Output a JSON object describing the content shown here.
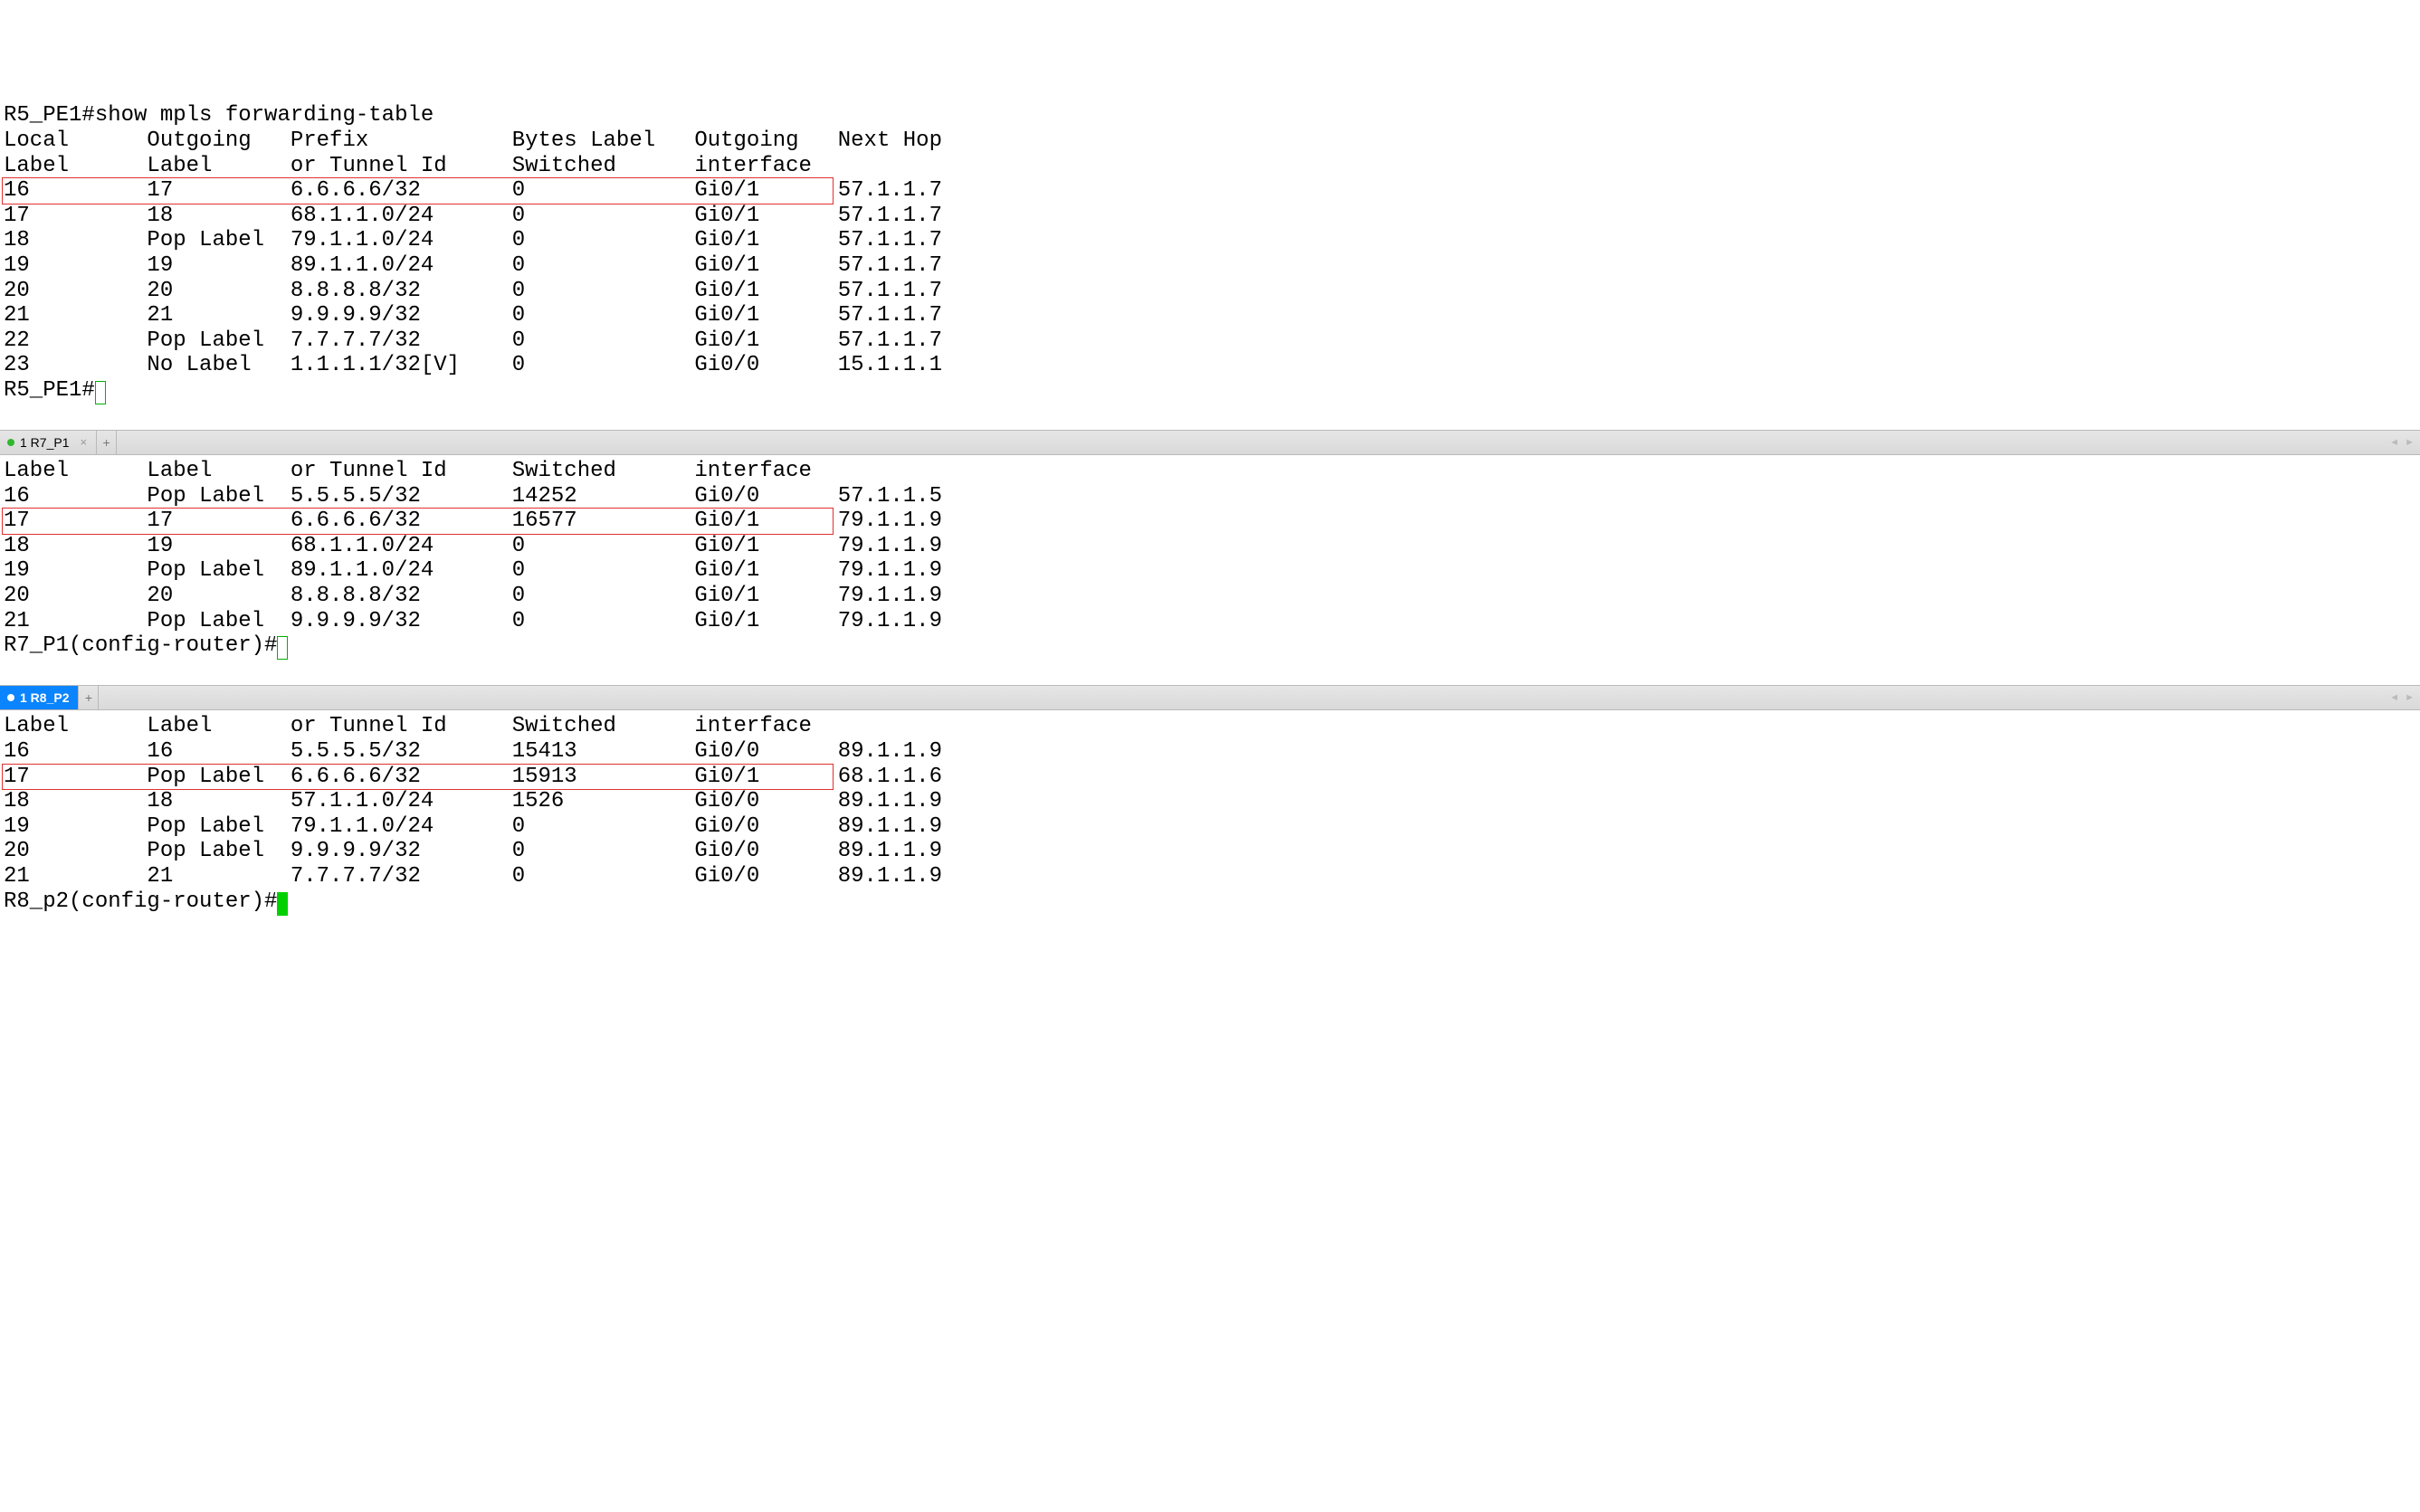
{
  "panes": [
    {
      "id": "r5",
      "command": "R5_PE1#show mpls forwarding-table",
      "prompt": "R5_PE1#",
      "headers": {
        "local": "Local      Outgoing   Prefix           Bytes Label   Outgoing   Next Hop",
        "label": "Label      Label      or Tunnel Id     Switched      interface"
      },
      "rows": [
        {
          "local": "16",
          "out": "17",
          "prefix": "6.6.6.6/32",
          "bytes": "0",
          "iface": "Gi0/1",
          "nh": "57.1.1.7",
          "hl": true
        },
        {
          "local": "17",
          "out": "18",
          "prefix": "68.1.1.0/24",
          "bytes": "0",
          "iface": "Gi0/1",
          "nh": "57.1.1.7"
        },
        {
          "local": "18",
          "out": "Pop Label",
          "prefix": "79.1.1.0/24",
          "bytes": "0",
          "iface": "Gi0/1",
          "nh": "57.1.1.7"
        },
        {
          "local": "19",
          "out": "19",
          "prefix": "89.1.1.0/24",
          "bytes": "0",
          "iface": "Gi0/1",
          "nh": "57.1.1.7"
        },
        {
          "local": "20",
          "out": "20",
          "prefix": "8.8.8.8/32",
          "bytes": "0",
          "iface": "Gi0/1",
          "nh": "57.1.1.7"
        },
        {
          "local": "21",
          "out": "21",
          "prefix": "9.9.9.9/32",
          "bytes": "0",
          "iface": "Gi0/1",
          "nh": "57.1.1.7"
        },
        {
          "local": "22",
          "out": "Pop Label",
          "prefix": "7.7.7.7/32",
          "bytes": "0",
          "iface": "Gi0/1",
          "nh": "57.1.1.7"
        },
        {
          "local": "23",
          "out": "No Label",
          "prefix": "1.1.1.1/32[V]",
          "bytes": "0",
          "iface": "Gi0/0",
          "nh": "15.1.1.1"
        }
      ]
    },
    {
      "id": "r7",
      "tab": {
        "label": "1 R7_P1",
        "active": false
      },
      "prompt": "R7_P1(config-router)#",
      "headers": {
        "label": "Label      Label      or Tunnel Id     Switched      interface"
      },
      "rows": [
        {
          "local": "16",
          "out": "Pop Label",
          "prefix": "5.5.5.5/32",
          "bytes": "14252",
          "iface": "Gi0/0",
          "nh": "57.1.1.5"
        },
        {
          "local": "17",
          "out": "17",
          "prefix": "6.6.6.6/32",
          "bytes": "16577",
          "iface": "Gi0/1",
          "nh": "79.1.1.9",
          "hl": true
        },
        {
          "local": "18",
          "out": "19",
          "prefix": "68.1.1.0/24",
          "bytes": "0",
          "iface": "Gi0/1",
          "nh": "79.1.1.9"
        },
        {
          "local": "19",
          "out": "Pop Label",
          "prefix": "89.1.1.0/24",
          "bytes": "0",
          "iface": "Gi0/1",
          "nh": "79.1.1.9"
        },
        {
          "local": "20",
          "out": "20",
          "prefix": "8.8.8.8/32",
          "bytes": "0",
          "iface": "Gi0/1",
          "nh": "79.1.1.9"
        },
        {
          "local": "21",
          "out": "Pop Label",
          "prefix": "9.9.9.9/32",
          "bytes": "0",
          "iface": "Gi0/1",
          "nh": "79.1.1.9"
        }
      ]
    },
    {
      "id": "r8",
      "tab": {
        "label": "1 R8_P2",
        "active": true
      },
      "prompt": "R8_p2(config-router)#",
      "headers": {
        "label": "Label      Label      or Tunnel Id     Switched      interface"
      },
      "rows": [
        {
          "local": "16",
          "out": "16",
          "prefix": "5.5.5.5/32",
          "bytes": "15413",
          "iface": "Gi0/0",
          "nh": "89.1.1.9"
        },
        {
          "local": "17",
          "out": "Pop Label",
          "prefix": "6.6.6.6/32",
          "bytes": "15913",
          "iface": "Gi0/1",
          "nh": "68.1.1.6",
          "hl": true
        },
        {
          "local": "18",
          "out": "18",
          "prefix": "57.1.1.0/24",
          "bytes": "1526",
          "iface": "Gi0/0",
          "nh": "89.1.1.9"
        },
        {
          "local": "19",
          "out": "Pop Label",
          "prefix": "79.1.1.0/24",
          "bytes": "0",
          "iface": "Gi0/0",
          "nh": "89.1.1.9"
        },
        {
          "local": "20",
          "out": "Pop Label",
          "prefix": "9.9.9.9/32",
          "bytes": "0",
          "iface": "Gi0/0",
          "nh": "89.1.1.9"
        },
        {
          "local": "21",
          "out": "21",
          "prefix": "7.7.7.7/32",
          "bytes": "0",
          "iface": "Gi0/0",
          "nh": "89.1.1.9"
        }
      ]
    }
  ],
  "ui": {
    "add_tab": "+",
    "scroll_left": "◄",
    "scroll_right": "►",
    "close_x": "×"
  }
}
